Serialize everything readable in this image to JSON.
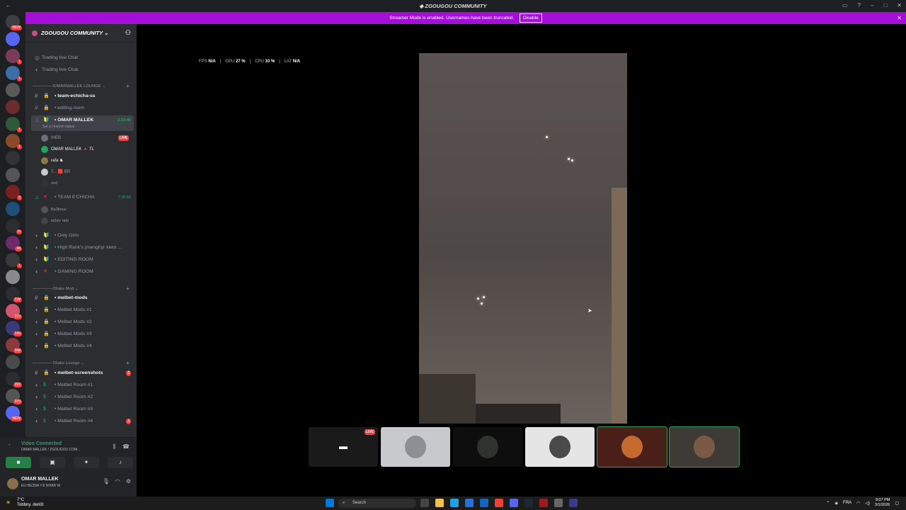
{
  "app": {
    "title": "ZGOUGOU COMMUNITY"
  },
  "banner": {
    "text": "Streamer Mode is enabled. Usernames have been truncated.",
    "button": "Disable"
  },
  "servers": [
    {
      "badge": "NEW"
    },
    {
      "badge": ""
    },
    {
      "badge": "1"
    },
    {
      "badge": "1"
    },
    {
      "badge": ""
    },
    {
      "badge": ""
    },
    {
      "badge": "1"
    },
    {
      "badge": "1"
    },
    {
      "badge": ""
    },
    {
      "badge": ""
    },
    {
      "badge": "2"
    },
    {
      "badge": ""
    },
    {
      "badge": "rs"
    },
    {
      "badge": "48"
    },
    {
      "badge": "1"
    },
    {
      "badge": ""
    },
    {
      "badge": "CW"
    },
    {
      "badge": "373"
    },
    {
      "badge": "149"
    },
    {
      "badge": "348"
    },
    {
      "badge": ""
    },
    {
      "badge": "292"
    },
    {
      "badge": "370"
    },
    {
      "badge": "NEW"
    }
  ],
  "guild": {
    "name": "ZGOUGOU COMMUNITY"
  },
  "channels": [
    {
      "label": "Trading live Chat"
    },
    {
      "label": "Trading live Chat"
    }
  ],
  "cat1": "IOMARMALLEK LOUNGE",
  "text1": [
    {
      "label": "team-echicha-ss"
    },
    {
      "label": "editing-room"
    }
  ],
  "voice_omar": {
    "label": "OMAR MALLEK",
    "time": "2:23:40",
    "status": "Set a channel status"
  },
  "voice_users": [
    {
      "name": "IHEB",
      "live": "LIVE"
    },
    {
      "name": "OMAR MALLEK",
      "live": ""
    },
    {
      "name": "rafa",
      "live": ""
    },
    {
      "name": "T...",
      "live": ""
    },
    {
      "name": "zied",
      "live": ""
    }
  ],
  "voice_team": {
    "label": "TEAM E'CHICHA",
    "time": "7:38:56"
  },
  "team_users": [
    {
      "name": "Ba3bous"
    },
    {
      "name": "la3zlz rabi"
    }
  ],
  "voice_more": [
    {
      "label": "Only Girls"
    },
    {
      "label": "High Rank's (menghyr klem ..."
    },
    {
      "label": "EDITING ROOM"
    },
    {
      "label": "GAMING ROOM"
    }
  ],
  "cat2": "IStake Mod",
  "mods": [
    {
      "label": "melbet-mods"
    },
    {
      "label": "Melbet Mods #1"
    },
    {
      "label": "Melbet Mods #2"
    },
    {
      "label": "Melbet Mods #3"
    },
    {
      "label": "Melbet Mods #4"
    }
  ],
  "cat3": "IStake Lounge",
  "lounge": [
    {
      "label": "melbet-screenshots",
      "badge": "2"
    },
    {
      "label": "Melbet Room #1",
      "badge": ""
    },
    {
      "label": "Melbet Room #2",
      "badge": ""
    },
    {
      "label": "Melbet Room #3",
      "badge": ""
    },
    {
      "label": "Melbet Room #4",
      "badge": "3"
    }
  ],
  "voice_status": {
    "title": "Video Connected",
    "sub": "OMAR MALLEK / ZGOUGOU COM..."
  },
  "user": {
    "name": "OMAR MALLEK",
    "status": "ELI BE3NA YJI NHAR W"
  },
  "stats": {
    "fps_label": "FPS",
    "fps": "N/A",
    "gpu_label": "GPU",
    "gpu": "27 %",
    "cpu_label": "CPU",
    "cpu": "10 %",
    "lat_label": "LAT",
    "lat": "N/A"
  },
  "thumbs": [
    {
      "badge": "LIVE"
    },
    {
      "badge": ""
    },
    {
      "badge": ""
    },
    {
      "badge": ""
    },
    {
      "badge": ""
    },
    {
      "badge": ""
    }
  ],
  "taskbar": {
    "temp": "7°C",
    "weather": "Tobbny. deriűt",
    "search": "Search",
    "lang": "FRA",
    "time": "9:07 PM",
    "date": "3/1/2026"
  }
}
